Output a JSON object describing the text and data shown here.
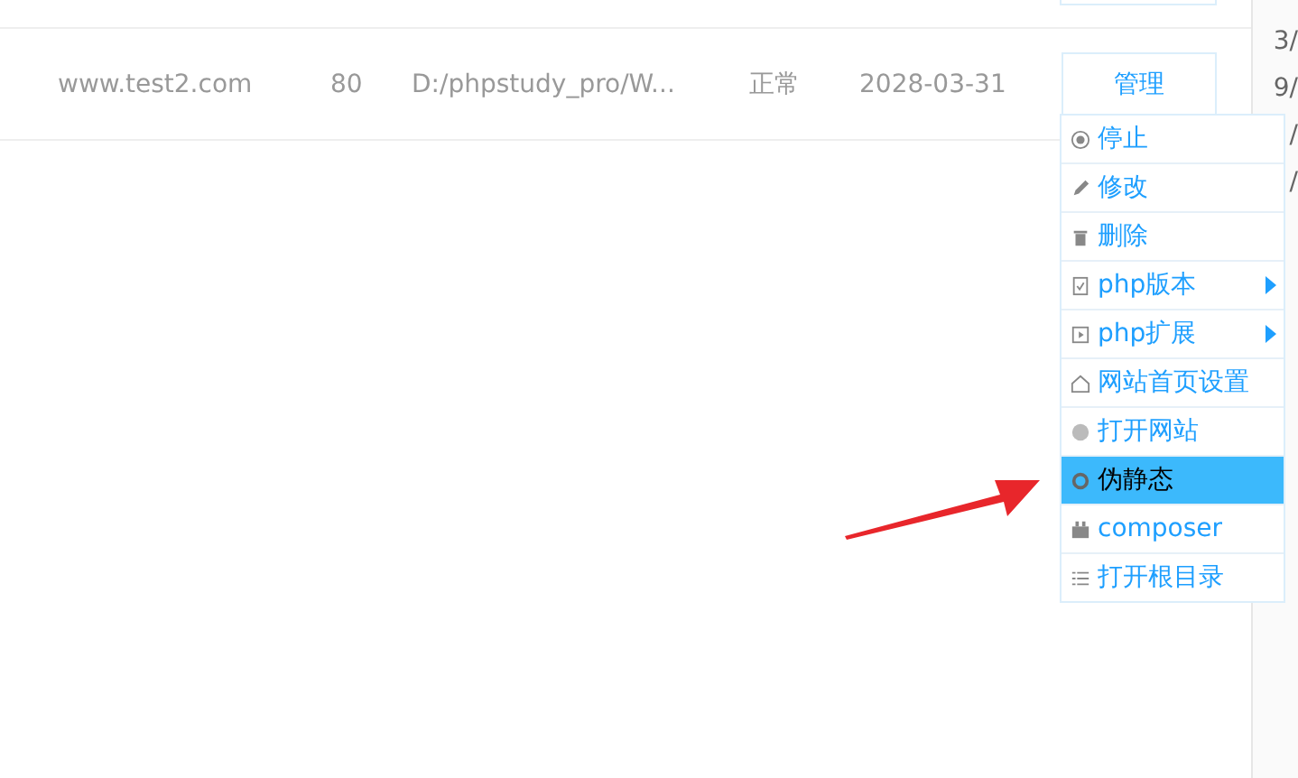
{
  "row": {
    "domain": "www.test2.com",
    "port": "80",
    "path": "D:/phpstudy_pro/W...",
    "status": "正常",
    "expiry": "2028-03-31",
    "action": "管理"
  },
  "menu": [
    {
      "kind": "stop",
      "label": "停止",
      "selected": false,
      "submenu": false
    },
    {
      "kind": "pencil",
      "label": "修改",
      "selected": false,
      "submenu": false
    },
    {
      "kind": "trash",
      "label": "删除",
      "selected": false,
      "submenu": false
    },
    {
      "kind": "version",
      "label": "php版本",
      "selected": false,
      "submenu": true
    },
    {
      "kind": "extension",
      "label": "php扩展",
      "selected": false,
      "submenu": true
    },
    {
      "kind": "home",
      "label": "网站首页设置",
      "selected": false,
      "submenu": false
    },
    {
      "kind": "globe",
      "label": "打开网站",
      "selected": false,
      "submenu": false
    },
    {
      "kind": "ring",
      "label": "伪静态",
      "selected": true,
      "submenu": false
    },
    {
      "kind": "package",
      "label": "composer",
      "selected": false,
      "submenu": false
    },
    {
      "kind": "list",
      "label": "打开根目录",
      "selected": false,
      "submenu": false
    }
  ],
  "side_fragments": [
    "3/",
    "9/",
    "/",
    "/"
  ]
}
